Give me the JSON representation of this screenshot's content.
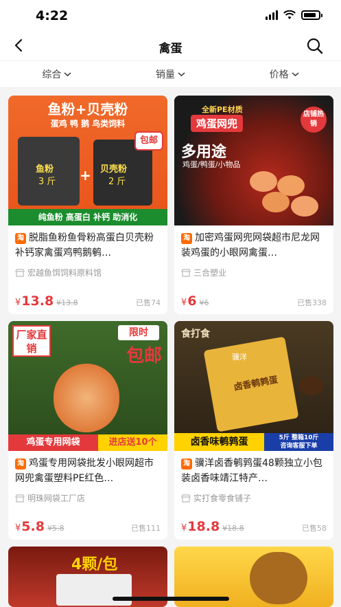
{
  "status_bar": {
    "time": "4:22"
  },
  "nav": {
    "title": "禽蛋"
  },
  "filters": [
    {
      "label": "综合",
      "arrow": "⌄"
    },
    {
      "label": "销量",
      "arrow": "⌄"
    },
    {
      "label": "价格",
      "arrow": "⌄"
    }
  ],
  "currency": "¥",
  "platform_badge": "淘",
  "products": [
    {
      "img_text_1": "鱼粉+贝壳粉",
      "img_text_2": "蛋鸡 鸭 鹅 鸟类饲料",
      "img_text_3": "包邮",
      "img_text_4": "鱼粉",
      "img_text_5": "3 斤",
      "img_text_6": "贝壳粉",
      "img_text_7": "2 斤",
      "img_text_8": "纯鱼粉 高蛋白 补钙 助消化",
      "title": "脱脂鱼粉鱼骨粉高蛋白贝壳粉补钙家禽蛋鸡鸭鹅鹌…",
      "shop": "宏越鱼饵饲料原料馆",
      "price": "13.8",
      "orig": "¥13.8",
      "sold": "已售74"
    },
    {
      "img_text_1": "全新PE材质",
      "img_text_2": "鸡蛋网兜",
      "img_text_3": "店铺热销",
      "img_text_4": "多用途",
      "img_text_5": "鸡蛋/鸭蛋/小物品",
      "title": "加密鸡蛋网兜网袋超市尼龙网装鸡蛋的小眼网禽蛋…",
      "shop": "三合塑业",
      "price": "6",
      "orig": "¥6",
      "sold": "已售338"
    },
    {
      "img_text_1": "厂家直销",
      "img_text_2": "限时",
      "img_text_3": "包邮",
      "img_text_4": "鸡蛋专用网袋",
      "img_text_5": "进店送10个",
      "title": "鸡蛋专用网袋批发小眼网超市网兜禽蛋塑料PE红色…",
      "shop": "明珠网袋工厂店",
      "price": "5.8",
      "orig": "¥5.8",
      "sold": "已售111"
    },
    {
      "img_text_1": "食打食",
      "img_text_2": "骥洋",
      "img_text_3": "卤香鹌鹑蛋",
      "img_text_4": "卤香味鹌鹑蛋",
      "img_text_5": "5斤 整箱10斤",
      "img_text_6": "咨询客服下单",
      "title": "骥洋卤香鹌鹑蛋48颗独立小包装卤香味靖江特产…",
      "shop": "实打食零食铺子",
      "price": "18.8",
      "orig": "¥18.8",
      "sold": "已售58"
    }
  ],
  "partial_cards": [
    {
      "img_text_1": "4颗/包"
    },
    {
      "img_text_1": ""
    }
  ]
}
